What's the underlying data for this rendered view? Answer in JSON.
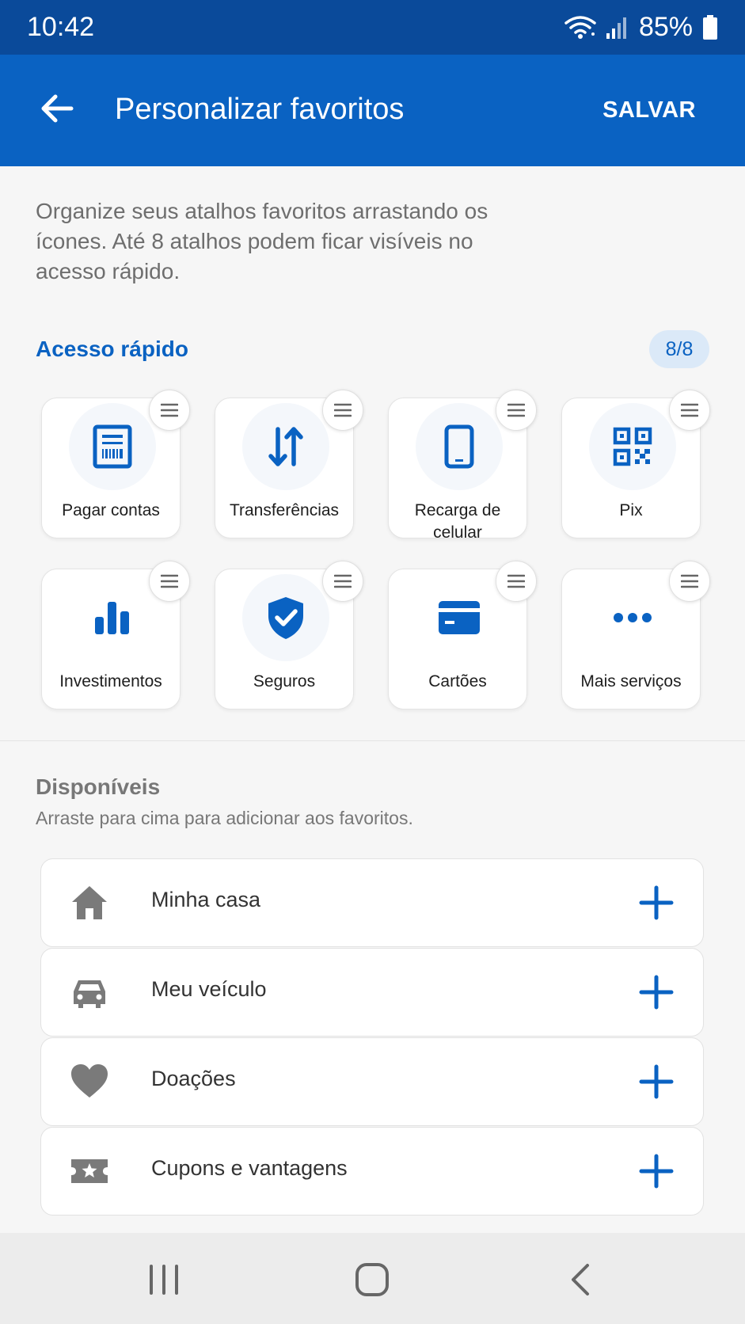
{
  "status_bar": {
    "time": "10:42",
    "battery": "85%"
  },
  "app_bar": {
    "title": "Personalizar favoritos",
    "save_label": "SALVAR",
    "back_icon": "arrow-left-icon"
  },
  "intro": "Organize seus atalhos favoritos arrastando os ícones. Até 8 atalhos podem ficar visíveis no acesso rápido.",
  "quick_access": {
    "title": "Acesso rápido",
    "count": "8/8",
    "items": [
      {
        "label": "Pagar contas",
        "icon": "bill-icon"
      },
      {
        "label": "Transferências",
        "icon": "transfer-arrows-icon"
      },
      {
        "label": "Recarga de celular",
        "icon": "phone-icon"
      },
      {
        "label": "Pix",
        "icon": "qr-code-icon"
      },
      {
        "label": "Investimentos",
        "icon": "bar-chart-icon"
      },
      {
        "label": "Seguros",
        "icon": "shield-check-icon"
      },
      {
        "label": "Cartões",
        "icon": "credit-card-icon"
      },
      {
        "label": "Mais serviços",
        "icon": "more-dots-icon"
      }
    ]
  },
  "available": {
    "title": "Disponíveis",
    "subtitle": "Arraste para cima para adicionar aos favoritos.",
    "items": [
      {
        "label": "Minha casa",
        "icon": "home-icon"
      },
      {
        "label": "Meu veículo",
        "icon": "car-icon"
      },
      {
        "label": "Doações",
        "icon": "heart-icon"
      },
      {
        "label": "Cupons e vantagens",
        "icon": "coupon-icon"
      }
    ]
  },
  "colors": {
    "primary": "#0a62c2",
    "status_bar": "#0a4a9a",
    "badge_bg": "#dbe9f8",
    "muted_icon": "#7a7a7a"
  }
}
